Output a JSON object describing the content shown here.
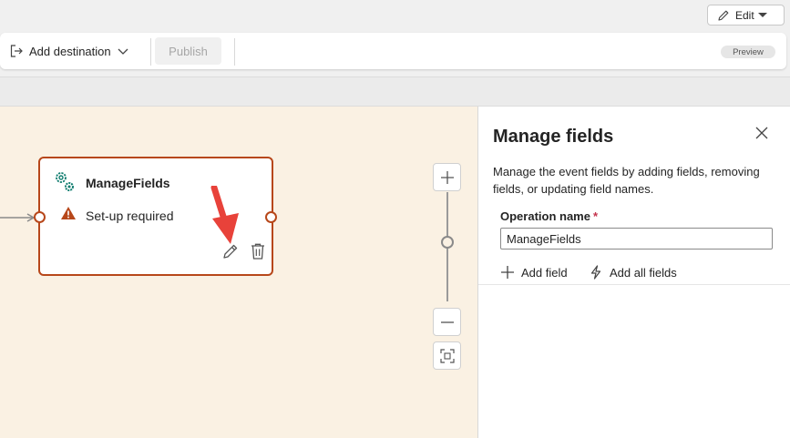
{
  "header": {
    "edit_label": "Edit"
  },
  "toolbar": {
    "add_destination_label": "Add destination",
    "publish_label": "Publish",
    "preview_badge": "Preview"
  },
  "canvas": {
    "node": {
      "title": "ManageFields",
      "status": "Set-up required"
    },
    "zoom": {
      "zoom_in_icon": "plus-icon",
      "zoom_out_icon": "minus-icon",
      "fit_icon": "fit-to-screen-icon"
    }
  },
  "panel": {
    "title": "Manage fields",
    "description": "Manage the event fields by adding fields, removing fields, or updating field names.",
    "operation_label": "Operation name",
    "required_marker": "*",
    "operation_value": "ManageFields",
    "add_field_label": "Add field",
    "add_all_fields_label": "Add all fields"
  },
  "colors": {
    "accent": "#b7471a",
    "canvas_bg": "#faf1e3",
    "icon_teal": "#0f7c6e",
    "annotation_arrow": "#e8423a"
  }
}
